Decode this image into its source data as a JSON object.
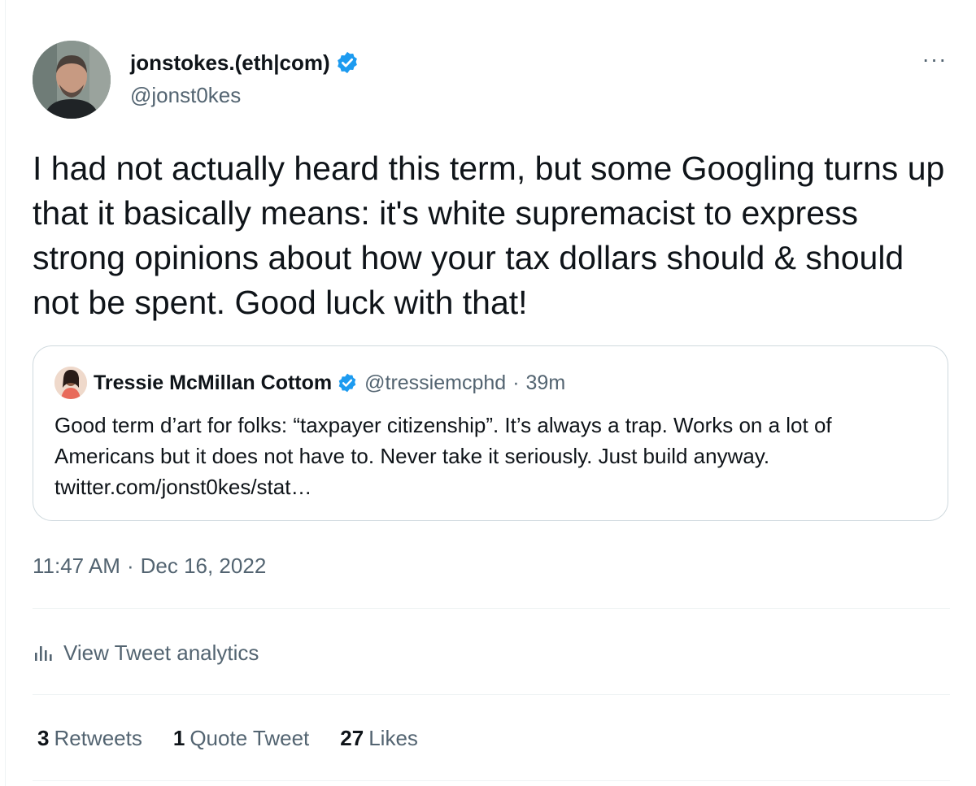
{
  "author": {
    "display_name": "jonstokes.(eth|com)",
    "handle": "@jonst0kes",
    "verified": true,
    "avatar_icon": "avatar-photo"
  },
  "menu": {
    "more_label": "···",
    "icon": "more-horizontal-icon"
  },
  "tweet": {
    "text": "I had not actually heard this term, but some Googling turns up that it basically means: it's white supremacist to express strong opinions about how your tax dollars should & should not be spent. Good luck with that!"
  },
  "quote": {
    "author_name": "Tressie McMillan Cottom",
    "handle": "@tressiemcphd",
    "separator": "·",
    "time": "39m",
    "verified": true,
    "text": "Good term d’art for folks: “taxpayer citizenship”. It’s always a trap. Works on a lot of Americans but it does not have to. Never take it seriously. Just build anyway. twitter.com/jonst0kes/stat…"
  },
  "meta": {
    "time": "11:47 AM",
    "separator": "·",
    "date": "Dec 16, 2022"
  },
  "analytics": {
    "label": "View Tweet analytics",
    "icon": "analytics-bars-icon"
  },
  "stats": [
    {
      "count": "3",
      "label": "Retweets"
    },
    {
      "count": "1",
      "label": "Quote Tweet"
    },
    {
      "count": "27",
      "label": "Likes"
    }
  ],
  "colors": {
    "verified_badge": "#1d9bf0",
    "text_primary": "#0f1419",
    "text_secondary": "#536471",
    "border": "#cfd9de",
    "divider": "#eff3f4"
  }
}
